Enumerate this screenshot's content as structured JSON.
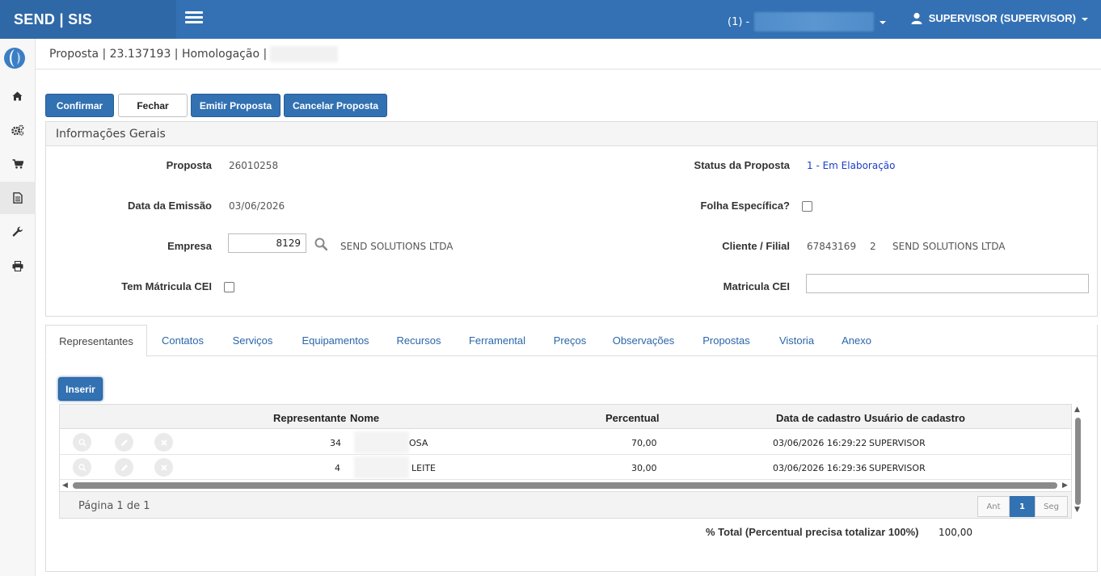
{
  "topbar": {
    "brand": "SEND | SIS",
    "company_prefix": "(1) -",
    "user": "SUPERVISOR (SUPERVISOR)"
  },
  "sidebar": {
    "items": [
      {
        "icon": "home-icon"
      },
      {
        "icon": "gears-icon"
      },
      {
        "icon": "cart-icon"
      },
      {
        "icon": "document-icon"
      },
      {
        "icon": "wrench-icon"
      },
      {
        "icon": "print-icon"
      }
    ]
  },
  "header": {
    "title": "Proposta | 23.137193 | Homologação |"
  },
  "toolbar": {
    "confirm": "Confirmar",
    "close": "Fechar",
    "emit": "Emitir Proposta",
    "cancel": "Cancelar Proposta"
  },
  "general": {
    "title": "Informações Gerais",
    "proposta_label": "Proposta",
    "proposta_value": "26010258",
    "emissao_label": "Data da Emissão",
    "emissao_value": "03/06/2026",
    "empresa_label": "Empresa",
    "empresa_code": "8129",
    "empresa_name": "SEND SOLUTIONS LTDA",
    "matricula_cei_check_label": "Tem Mátricula CEI",
    "status_label": "Status da Proposta",
    "status_value": "1 - Em Elaboração",
    "folha_label": "Folha Específica?",
    "cliente_label": "Cliente / Filial",
    "cliente_code": "67843169",
    "filial_code": "2",
    "cliente_name": "SEND SOLUTIONS LTDA",
    "matricula_label": "Matricula CEI",
    "matricula_value": ""
  },
  "tabs": [
    {
      "label": "Representantes"
    },
    {
      "label": "Contatos"
    },
    {
      "label": "Serviços"
    },
    {
      "label": "Equipamentos"
    },
    {
      "label": "Recursos"
    },
    {
      "label": "Ferramental"
    },
    {
      "label": "Preços"
    },
    {
      "label": "Observações"
    },
    {
      "label": "Propostas"
    },
    {
      "label": "Vistoria"
    },
    {
      "label": "Anexo"
    }
  ],
  "insert_label": "Inserir",
  "grid": {
    "columns": {
      "representante": "Representante",
      "nome": "Nome",
      "percentual": "Percentual",
      "data": "Data de cadastro",
      "usuario": "Usuário de cadastro"
    },
    "rows": [
      {
        "representante": "34",
        "nome": "OSA",
        "percentual": "70,00",
        "data": "03/06/2026 16:29:22",
        "usuario": "SUPERVISOR"
      },
      {
        "representante": "4",
        "nome": "LEITE",
        "percentual": "30,00",
        "data": "03/06/2026 16:29:36",
        "usuario": "SUPERVISOR"
      }
    ],
    "pager_text": "Página 1 de 1",
    "prev": "Ant",
    "page": "1",
    "next": "Seg"
  },
  "total": {
    "label": "% Total (Percentual precisa totalizar 100%)",
    "value": "100,00"
  }
}
